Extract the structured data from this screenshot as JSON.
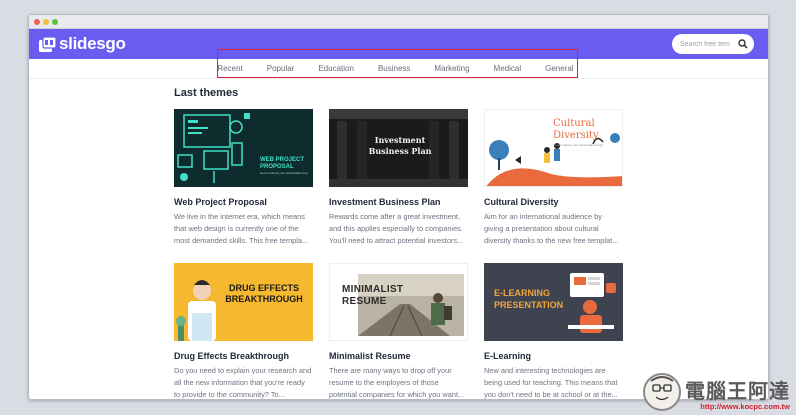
{
  "brand": {
    "name": "slidesgo",
    "accent": "#6a5cf0"
  },
  "search": {
    "placeholder": "Search free tem"
  },
  "nav": {
    "items": [
      "Recent",
      "Popular",
      "Education",
      "Business",
      "Marketing",
      "Medical",
      "General"
    ]
  },
  "section": {
    "title": "Last themes"
  },
  "themes": [
    {
      "title": "Web Project Proposal",
      "desc": "We live in the internet era, which means that web design is currently one of the most demanded skills. This free templa...",
      "thumb_text": "WEB PROJECT PROPOSAL",
      "thumb_sub": "Here is where your presentation begins"
    },
    {
      "title": "Investment Business Plan",
      "desc": "Rewards come after a great investment, and this applies especially to companies. You'll need to attract potential investors...",
      "thumb_text": "Investment Business Plan"
    },
    {
      "title": "Cultural Diversity",
      "desc": "Aim for an international audience by giving a presentation about cultural diversity thanks to the new free templat...",
      "thumb_text": "Cultural Diversity",
      "thumb_sub": "Here is where your presentation begins"
    },
    {
      "title": "Drug Effects Breakthrough",
      "desc": "Do you need to explain your research and all the new information that you're ready to provide to the community? To...",
      "thumb_text": "DRUG EFFECTS BREAKTHROUGH"
    },
    {
      "title": "Minimalist Resume",
      "desc": "There are many ways to drop off your resume to the employers of those potential companies for which you want...",
      "thumb_text": "MINIMALIST RESUME"
    },
    {
      "title": "E-Learning",
      "desc": "New and interesting technologies are being used for teaching. This means that you don't need to be at school or at the...",
      "thumb_text": "E-LEARNING PRESENTATION"
    }
  ],
  "watermark": {
    "text": "電腦王阿達",
    "url": "http://www.kocpc.com.tw"
  }
}
